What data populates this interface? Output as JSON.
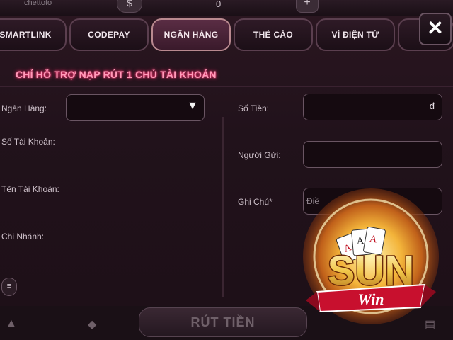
{
  "top": {
    "username": "chettoto",
    "coin_icon": "$",
    "balance": "0",
    "plus_icon": "+"
  },
  "tabs": [
    {
      "label": "SMARTLINK"
    },
    {
      "label": "CODEPAY"
    },
    {
      "label": "NGÂN HÀNG",
      "active": true
    },
    {
      "label": "THẺ CÀO"
    },
    {
      "label": "VÍ ĐIỆN TỬ"
    }
  ],
  "close_icon": "✕",
  "notice": "CHỈ HỖ TRỢ NẠP RÚT 1 CHỦ TÀI KHOẢN",
  "form_left": {
    "bank_label": "Ngân Hàng:",
    "bank_value": "",
    "bank_arrow": "▼",
    "account_number_label": "Số Tài Khoản:",
    "account_name_label": "Tên Tài Khoản:",
    "branch_label": "Chi Nhánh:"
  },
  "form_right": {
    "amount_label": "Số Tiền:",
    "amount_currency": "đ",
    "sender_label": "Người Gửi:",
    "note_label": "Ghi Chú*",
    "note_placeholder": "Điề"
  },
  "bottom": {
    "button_label": "RÚT TIỀN"
  },
  "logo": {
    "brand": "SUN",
    "sub": "Win"
  },
  "colors": {
    "notice": "#ff9bb9",
    "active_tab": "#5a2d44",
    "background": "#21121b"
  }
}
